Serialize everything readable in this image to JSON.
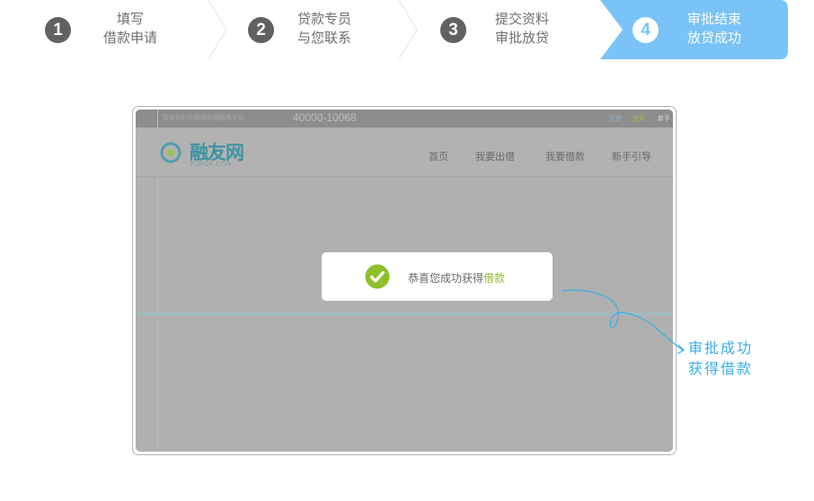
{
  "steps": [
    {
      "number": "1",
      "line1": "填写",
      "line2": "借款申请",
      "active": false
    },
    {
      "number": "2",
      "line1": "贷款专员",
      "line2": "与您联系",
      "active": false
    },
    {
      "number": "3",
      "line1": "提交资料",
      "line2": "审批放贷",
      "active": false
    },
    {
      "number": "4",
      "line1": "审批结束",
      "line2": "放贷成功",
      "active": true
    }
  ],
  "colors": {
    "active_step": "#79c3f8",
    "inactive_number": "#616161",
    "annotation": "#39aee8",
    "success": "#8fbf2a",
    "guide": "#7fd0de"
  },
  "preview": {
    "topbar": {
      "slogan": "您身边的互联网金融服务平台",
      "phone": "40000-10068",
      "links": [
        "注册",
        "登录",
        "新手"
      ]
    },
    "logo": {
      "text": "融友网",
      "sub": "P2POK.COM"
    },
    "nav": [
      "首页",
      "我要出借",
      "我要借款",
      "新手引导"
    ],
    "dialog": {
      "prefix": "恭喜您成功获得",
      "highlight": "借款"
    }
  },
  "annotation": {
    "line1": "审批成功",
    "line2": "获得借款"
  }
}
